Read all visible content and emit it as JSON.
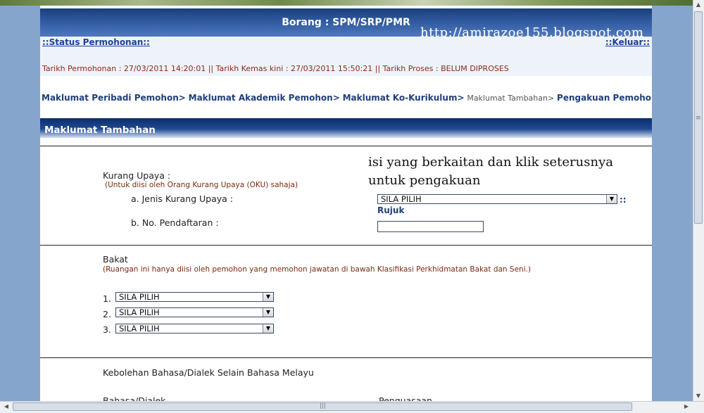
{
  "header": {
    "title": "Borang : SPM/SRP/PMR",
    "watermark": "http://amirazoe155.blogspot.com",
    "status_link": "::Status Permohonan::",
    "logout_link": "::Keluar::",
    "dates_line": "Tarikh Permohonan : 27/03/2011 14:20:01 || Tarikh Kemas kini : 27/03/2011 15:50:21 || Tarikh Proses : BELUM DIPROSES"
  },
  "breadcrumb": {
    "items": [
      "Maklumat Peribadi Pemohon>",
      "Maklumat Akademik Pemohon>",
      "Maklumat Ko-Kurikulum>",
      "Maklumat Tambahan>",
      "Pengakuan Pemohon"
    ],
    "current_index": 3
  },
  "section": {
    "title": "Maklumat Tambahan",
    "annotation": "isi yang berkaitan dan klik seterusnya untuk pengakuan"
  },
  "disability": {
    "heading": "Kurang Upaya :",
    "note": "(Untuk diisi oleh Orang Kurang Upaya (OKU) sahaja)",
    "type_label": "a. Jenis Kurang Upaya :",
    "type_value": "SILA PILIH",
    "rujuk_prefix": "::",
    "rujuk_label": "Rujuk",
    "registration_label": "b. No. Pendaftaran :",
    "registration_value": ""
  },
  "talent": {
    "heading": "Bakat",
    "note": "(Ruangan ini hanya diisi oleh pemohon yang memohon jawatan di bawah Klasifikasi Perkhidmatan Bakat dan Seni.)",
    "selects": [
      {
        "number": "1.",
        "value": "SILA PILIH"
      },
      {
        "number": "2.",
        "value": "SILA PILIH"
      },
      {
        "number": "3.",
        "value": "SILA PILIH"
      }
    ]
  },
  "language": {
    "heading": "Kebolehan Bahasa/Dialek Selain Bahasa Melayu",
    "col_language": "Bahasa/Dialek",
    "col_proficiency": "Penguasaan"
  },
  "icons": {
    "dropdown": "dropdown-arrow-icon",
    "scroll_up": "scroll-up-icon",
    "scroll_down": "scroll-down-icon",
    "scroll_left": "scroll-left-icon",
    "scroll_right": "scroll-right-icon"
  }
}
